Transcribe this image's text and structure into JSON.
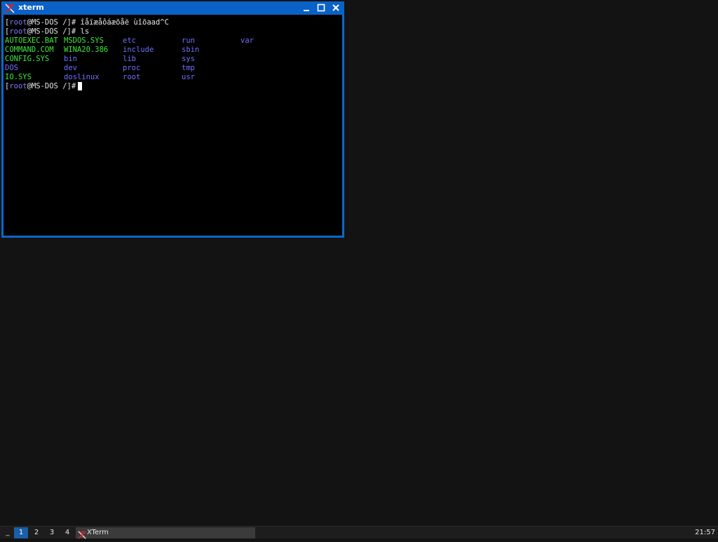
{
  "colors": {
    "desktop": "#131313",
    "window_frame": "#0d67c9",
    "terminal_bg": "#000000",
    "prompt_user": "#7d7dff",
    "executable": "#3dea3d",
    "directory": "#7070ff",
    "taskbar_active": "#1a5ea8"
  },
  "window": {
    "title": "xterm",
    "icon": "xterm-icon",
    "controls": [
      "minimize-icon",
      "maximize-icon",
      "close-icon"
    ]
  },
  "terminal": {
    "prompt": {
      "open": "[",
      "user": "root",
      "host_path": "@MS-DOS /]",
      "symbol": "#"
    },
    "line1_command": " îåïæåôáæõåë ùîõaad^C",
    "line2_command": " ls",
    "line3_command": " ",
    "ls_output": [
      [
        "AUTOEXEC.BAT",
        "MSDOS.SYS",
        "etc",
        "run",
        "var"
      ],
      [
        "COMMAND.COM",
        "WINA20.386",
        "include",
        "sbin"
      ],
      [
        "CONFIG.SYS",
        "bin",
        "lib",
        "sys"
      ],
      [
        "DOS",
        "dev",
        "proc",
        "tmp"
      ],
      [
        "IO.SYS",
        "doslinux",
        "root",
        "usr"
      ]
    ],
    "ls_types": [
      [
        "exe",
        "exe",
        "dir",
        "dir",
        "dir"
      ],
      [
        "exe",
        "exe",
        "dir",
        "dir"
      ],
      [
        "exe",
        "dir",
        "dir",
        "dir"
      ],
      [
        "dir",
        "dir",
        "dir",
        "dir"
      ],
      [
        "exe",
        "dir",
        "dir",
        "dir"
      ]
    ]
  },
  "taskbar": {
    "show_desktop": "_",
    "workspaces": [
      "1",
      "2",
      "3",
      "4"
    ],
    "active_workspace": "1",
    "task_label": "XTerm",
    "task_icon": "xterm-icon",
    "clock": "21:57"
  }
}
